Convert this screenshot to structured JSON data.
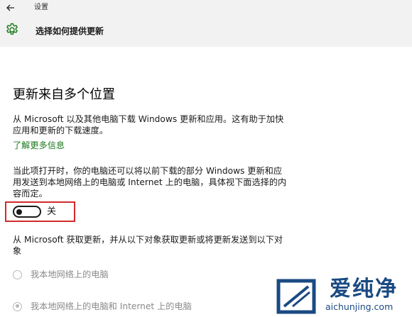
{
  "window": {
    "title": "设置"
  },
  "header": {
    "title": "选择如何提供更新"
  },
  "main": {
    "section_title": "更新来自多个位置",
    "intro": "从 Microsoft 以及其他电脑下载 Windows 更新和应用。这有助于加快应用和更新的下载速度。",
    "learn_more": "了解更多信息",
    "description": "当此项打开时，你的电脑还可以将以前下载的部分 Windows 更新和应用发送到本地网络上的电脑或 Internet 上的电脑，具体视下面选择的内容而定。",
    "toggle": {
      "state_label": "关",
      "on": false
    },
    "options_intro": "从 Microsoft 获取更新，并从以下对象获取更新或将更新发送到以下对象",
    "options": [
      {
        "label": "我本地网络上的电脑",
        "checked": false
      },
      {
        "label": "我本地网络上的电脑和 Internet 上的电脑",
        "checked": true
      }
    ]
  },
  "watermark": {
    "title": "爱纯净",
    "url": "aichunjing.com"
  },
  "colors": {
    "chrome_bg": "#f2f2f2",
    "link": "#1c7a1c",
    "highlight_box": "#d12a2a",
    "gear": "#1c7a1c",
    "disabled_text": "#8a8a8a",
    "watermark": "#1a4a82"
  },
  "icons": {
    "back": "back-arrow-icon",
    "settings": "gear-icon",
    "watermark_logo": "aichunjing-logo-icon"
  }
}
